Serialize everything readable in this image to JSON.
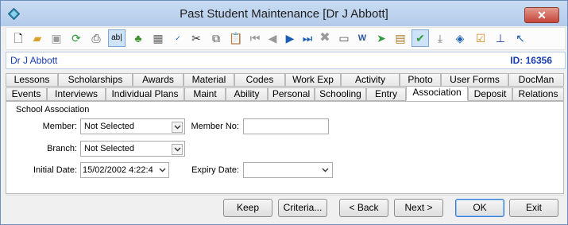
{
  "window": {
    "title": "Past Student Maintenance  [Dr J Abbott]",
    "close_label": "✕"
  },
  "toolbar": {
    "icons": [
      "new-document-icon",
      "open-folder-icon",
      "save-icon",
      "refresh-icon",
      "print-icon",
      "text-field-icon",
      "tree-icon",
      "calculator-icon",
      "spellcheck-icon",
      "cut-icon",
      "copy-icon",
      "paste-icon",
      "first-record-icon",
      "previous-record-icon",
      "next-record-icon",
      "last-record-icon",
      "delete-icon",
      "card-icon",
      "word-document-icon",
      "forward-icon",
      "clipboard-icon",
      "checked-tray-icon",
      "download-icon",
      "tag-icon",
      "task-checklist-icon",
      "pin-icon",
      "arrow-up-left-icon"
    ]
  },
  "record": {
    "name": "Dr J Abbott",
    "id_label": "ID: 16356"
  },
  "tabs": {
    "row1": [
      "Lessons",
      "Scholarships",
      "Awards",
      "Material",
      "Codes",
      "Work Exp",
      "Activity",
      "Photo",
      "User Forms",
      "DocMan"
    ],
    "row2": [
      "Events",
      "Interviews",
      "Individual Plans",
      "Maint",
      "Ability",
      "Personal",
      "Schooling",
      "Entry",
      "Association",
      "Deposit",
      "Relations"
    ],
    "active": "Association"
  },
  "form": {
    "group_label": "School Association",
    "member_label": "Member:",
    "member_value": "Not Selected",
    "member_no_label": "Member No:",
    "member_no_value": "",
    "branch_label": "Branch:",
    "branch_value": "Not Selected",
    "initial_date_label": "Initial Date:",
    "initial_date_value": "15/02/2002 4:22:4",
    "expiry_date_label": "Expiry Date:",
    "expiry_date_value": ""
  },
  "buttons": {
    "keep": "Keep",
    "criteria": "Criteria...",
    "back": "< Back",
    "next": "Next >",
    "ok": "OK",
    "exit": "Exit"
  },
  "colors": {
    "record_text": "#1a3cad",
    "title_bar": "#c9dcf2",
    "close_button": "#c7443a"
  }
}
